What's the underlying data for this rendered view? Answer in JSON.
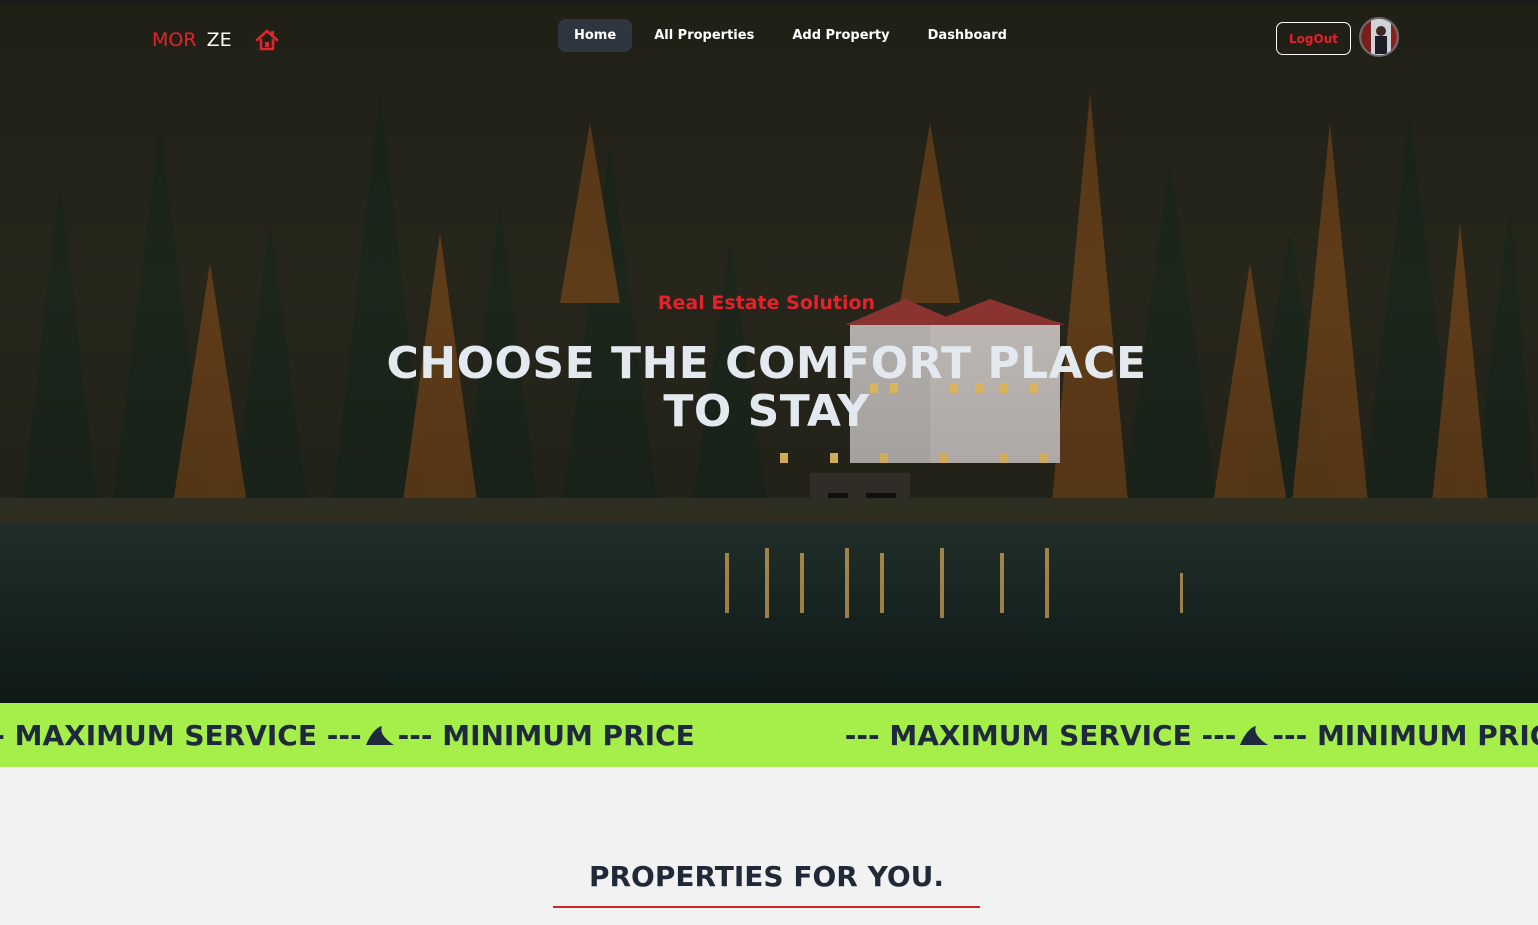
{
  "brand": {
    "part1": "MOR",
    "part2": "ZE",
    "icon": "house-icon",
    "accent_color": "#e3232b"
  },
  "nav": {
    "items": [
      {
        "label": "Home",
        "active": true
      },
      {
        "label": "All Properties",
        "active": false
      },
      {
        "label": "Add Property",
        "active": false
      },
      {
        "label": "Dashboard",
        "active": false
      }
    ],
    "logout_label": "LogOut",
    "avatar": "user-avatar"
  },
  "hero": {
    "tagline": "Real Estate Solution",
    "headline_line1": "CHOOSE THE COMFORT PLACE",
    "headline_line2": "TO STAY"
  },
  "marquee": {
    "background": "#a6ee4a",
    "segment1_left": "--- MAXIMUM SERVICE ---",
    "segment1_right": "--- MINIMUM PRICE",
    "segment2_left": "--- MAXIMUM SERVICE ---",
    "segment2_right": "--- MINIMUM PRICE ---",
    "icon": "bird-icon"
  },
  "section": {
    "title": "PROPERTIES FOR YOU.",
    "underline_color": "#c62828"
  }
}
